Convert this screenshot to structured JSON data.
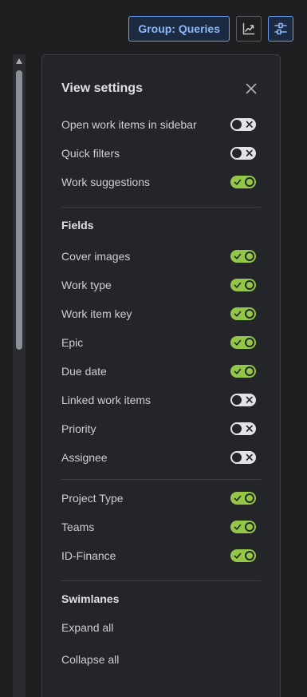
{
  "topbar": {
    "group_label": "Group: Queries"
  },
  "panel": {
    "title": "View settings",
    "general": [
      {
        "label": "Open work items in sidebar",
        "on": false
      },
      {
        "label": "Quick filters",
        "on": false
      },
      {
        "label": "Work suggestions",
        "on": true
      }
    ],
    "fields_title": "Fields",
    "fields": [
      {
        "label": "Cover images",
        "on": true
      },
      {
        "label": "Work type",
        "on": true
      },
      {
        "label": "Work item key",
        "on": true
      },
      {
        "label": "Epic",
        "on": true
      },
      {
        "label": "Due date",
        "on": true
      },
      {
        "label": "Linked work items",
        "on": false
      },
      {
        "label": "Priority",
        "on": false
      },
      {
        "label": "Assignee",
        "on": false
      }
    ],
    "custom_fields": [
      {
        "label": "Project Type",
        "on": true
      },
      {
        "label": "Teams",
        "on": true
      },
      {
        "label": "ID-Finance",
        "on": true
      }
    ],
    "swimlanes_title": "Swimlanes",
    "swimlane_actions": [
      "Expand all",
      "Collapse all"
    ]
  },
  "colors": {
    "toggle_on": "#94c748",
    "toggle_off": "#e2e3e6",
    "accent": "#669df1"
  }
}
